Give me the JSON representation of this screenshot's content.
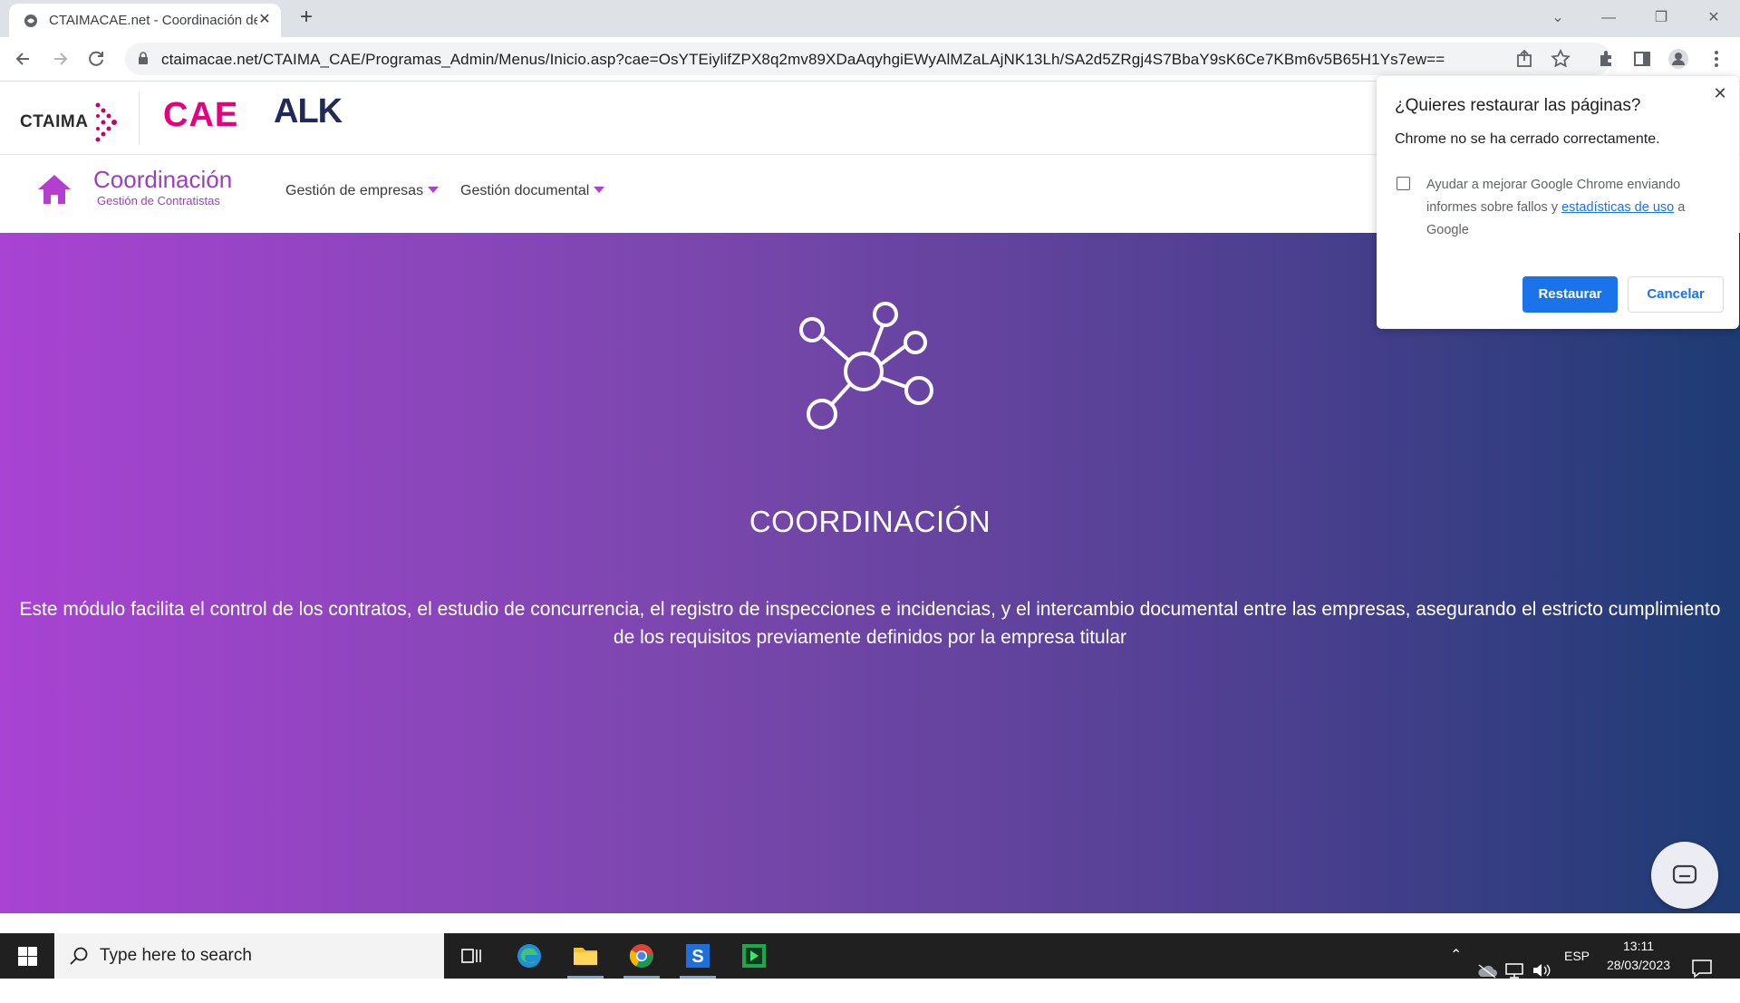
{
  "browser": {
    "tab_title": "CTAIMACAE.net - Coordinación de",
    "url": "ctaimacae.net/CTAIMA_CAE/Programas_Admin/Menus/Inicio.asp?cae=OsYTEiylifZPX8q2mv89XDaAqyhgiEWyAlMZaLAjNK13Lh/SA2d5ZRgj4S7BbaY9sK6Ce7KBm6v5B65H1Ys7ew=="
  },
  "site": {
    "logo_ctaima": "CTAIMA",
    "logo_cae": "CAE",
    "logo_alk": "ALK",
    "nav_title": "Coordinación",
    "nav_subtitle": "Gestión de Contratistas",
    "menu": [
      "Gestión de empresas",
      "Gestión documental"
    ]
  },
  "hero": {
    "title": "COORDINACIÓN",
    "description": "Este módulo facilita el control de los contratos, el estudio de concurrencia, el registro de inspecciones e incidencias, y el intercambio documental entre las empresas, asegurando el estricto cumplimiento de los requisitos previamente definidos por la empresa titular",
    "icon": "network-icon"
  },
  "popup": {
    "title": "¿Quieres restaurar las páginas?",
    "message": "Chrome no se ha cerrado correctamente.",
    "help_prefix": "Ayudar a mejorar Google Chrome enviando informes sobre fallos y ",
    "help_link": "estadísticas de uso",
    "help_suffix": " a Google",
    "restore_label": "Restaurar",
    "cancel_label": "Cancelar"
  },
  "taskbar": {
    "search_placeholder": "Type here to search",
    "language": "ESP",
    "time": "13:11",
    "date": "28/03/2023"
  },
  "colors": {
    "brand_purple": "#9b3fc2",
    "brand_pink": "#e6007e",
    "chrome_blue": "#1a73e8"
  }
}
